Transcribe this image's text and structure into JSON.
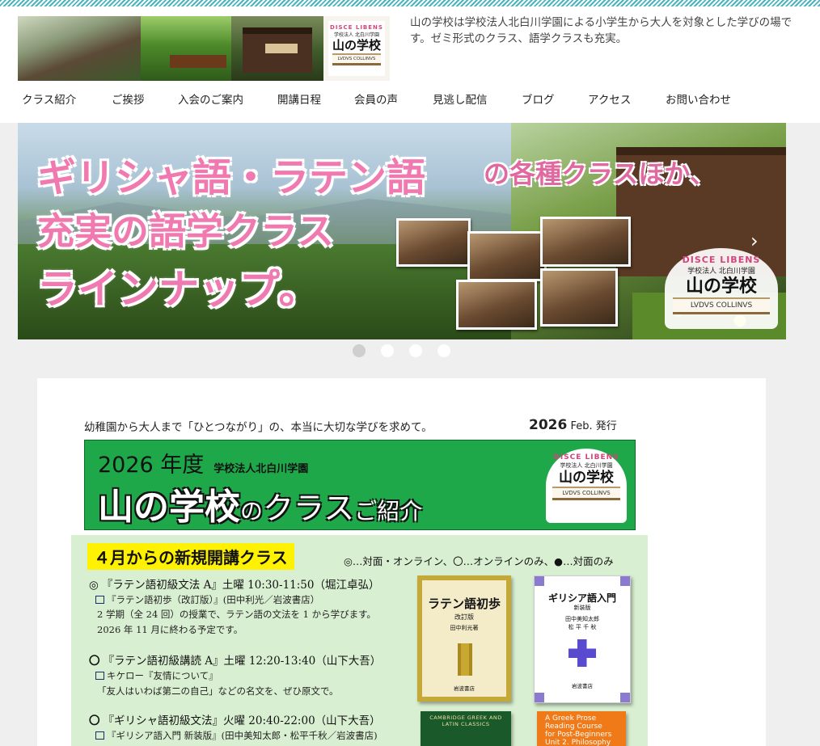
{
  "header": {
    "intro": "山の学校は学校法人北白川学園による小学生から大人を対象とした学びの場です。ゼミ形式のクラス、語学クラスも充実。",
    "logo": {
      "arc": "DISCE LIBENS",
      "sub": "学校法人 北白川学園",
      "name": "山の学校",
      "latin": "LVDVS COLLINVS"
    }
  },
  "nav": {
    "items": [
      {
        "label": "クラス紹介"
      },
      {
        "label": "ご挨拶"
      },
      {
        "label": "入会のご案内"
      },
      {
        "label": "開講日程"
      },
      {
        "label": "会員の声"
      },
      {
        "label": "見逃し配信"
      },
      {
        "label": "ブログ"
      },
      {
        "label": "アクセス"
      },
      {
        "label": "お問い合わせ"
      }
    ]
  },
  "slider": {
    "line1_a": "ギリシャ語・ラテン語",
    "line1_b": "の各種クラスほか、",
    "line2": "充実の語学クラス",
    "line3": "ラインナップ。",
    "arrow": "›",
    "logo": {
      "arc": "DISCE LIBENS",
      "sub": "学校法人 北白川学園",
      "name": "山の学校",
      "latin": "LVDVS COLLINVS"
    },
    "dots": 4,
    "active_dot": 0
  },
  "flyer": {
    "tagline": "幼稚園から大人まで「ひとつながり」の、本当に大切な学びを求めて。",
    "date_year": "2026",
    "date_month": " Feb. 発行",
    "banner": {
      "year": "2026 年度",
      "org": "学校法人北白川学園",
      "t1": "山の学校",
      "t2": "の",
      "t3": "クラス",
      "t4": "ご紹介",
      "logo": {
        "arc": "DISCE LIBENS",
        "sub": "学校法人 北白川学園",
        "name": "山の学校",
        "latin": "LVDVS COLLINVS"
      }
    },
    "new_classes": {
      "heading": "４月からの新規開講クラス",
      "legend": "◎…対面・オンライン、〇…オンラインのみ、●…対面のみ",
      "entries": [
        {
          "mark": "◎",
          "title": "『ラテン語初級文法 A』土曜 10:30-11:50（堀江卓弘）",
          "book": "『ラテン語初歩（改訂版）』(田中利光／岩波書店）",
          "lines": [
            "2 学期（全 24 回）の授業で、ラテン語の文法を 1 から学びます。",
            "2026 年 11 月に終わる予定です。"
          ]
        },
        {
          "mark": "〇",
          "title": "『ラテン語初級講読 A』土曜 12:20-13:40（山下大吾）",
          "book": "キケロー『友情について』",
          "lines": [
            "「友人はいわば第二の自己」などの名文を、ぜひ原文で。"
          ]
        },
        {
          "mark": "〇",
          "title": "『ギリシャ語初級文法』火曜 20:40-22:00（山下大吾）",
          "book": "『ギリシア語入門 新装版』(田中美知太郎・松平千秋／岩波書店)",
          "lines": []
        }
      ],
      "books": {
        "b1_title": "ラテン語初歩",
        "b1_ed": "改訂版",
        "b1_author": "田中利光著",
        "b1_pub": "岩波書店",
        "b2_title": "ギリシア語入門",
        "b2_ed": "新装版",
        "b2_author1": "田中美知太郎",
        "b2_author2": "松 平 千 秋",
        "b2_pub": "岩波書店",
        "b3_title": "CAMBRIDGE GREEK AND LATIN CLASSICS",
        "b4_l1": "A Greek Prose",
        "b4_l2": "Reading Course",
        "b4_l3": "for Post-Beginners",
        "b4_l4": "Unit 2. Philosophy"
      }
    }
  },
  "colors": {
    "accent_teal": "#4ab4c0",
    "banner_green": "#1ea84a",
    "headline_pink": "#f07ab0",
    "highlight_yellow": "#fff200",
    "panel_green": "#d9efd1"
  }
}
